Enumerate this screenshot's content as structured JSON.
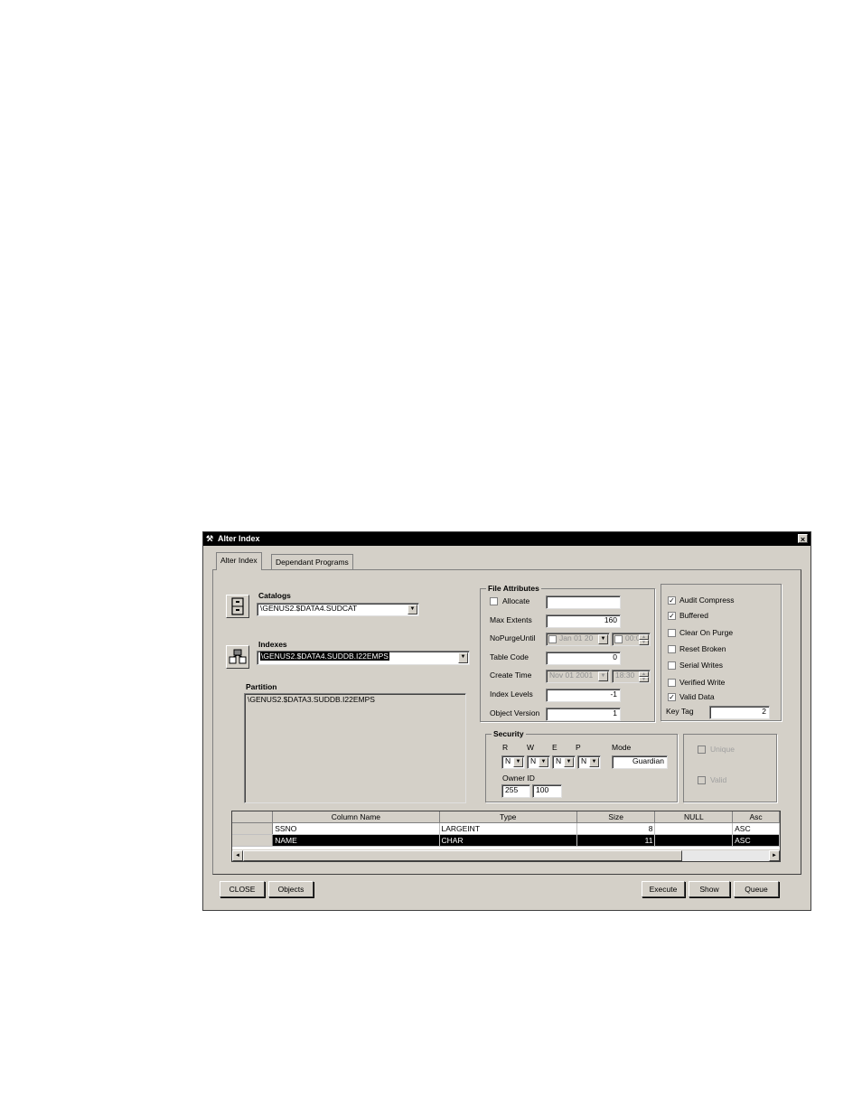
{
  "window": {
    "title": "Alter Index",
    "close_glyph": "×"
  },
  "tabs": [
    {
      "label": "Alter Index",
      "active": true
    },
    {
      "label": "Dependant Programs",
      "active": false
    }
  ],
  "catalogs": {
    "label": "Catalogs",
    "value": "\\GENUS2.$DATA4.SUDCAT"
  },
  "indexes": {
    "label": "Indexes",
    "value": "\\GENUS2.$DATA4.SUDDB.I22EMPS"
  },
  "partition": {
    "label": "Partition",
    "items": [
      "\\GENUS2.$DATA3.SUDDB.I22EMPS"
    ]
  },
  "file_attributes": {
    "title": "File Attributes",
    "allocate": {
      "label": "Allocate",
      "checked": false,
      "value": ""
    },
    "max_extents": {
      "label": "Max Extents",
      "value": "160"
    },
    "no_purge_until": {
      "label": "NoPurgeUntil",
      "date": "Jan 01 20",
      "time": "00:0"
    },
    "table_code": {
      "label": "Table Code",
      "value": "0"
    },
    "create_time": {
      "label": "Create Time",
      "date": "Nov 01 2001",
      "time": "18:30"
    },
    "index_levels": {
      "label": "Index Levels",
      "value": "-1"
    },
    "object_version": {
      "label": "Object Version",
      "value": "1"
    }
  },
  "flags": {
    "audit_compress": {
      "label": "Audit Compress",
      "checked": true
    },
    "buffered": {
      "label": "Buffered",
      "checked": true
    },
    "clear_on_purge": {
      "label": "Clear On Purge",
      "checked": false
    },
    "reset_broken": {
      "label": "Reset Broken",
      "checked": false
    },
    "serial_writes": {
      "label": "Serial Writes",
      "checked": false
    },
    "verified_write": {
      "label": "Verified Write",
      "checked": false
    },
    "valid_data": {
      "label": "Valid Data",
      "checked": true
    },
    "key_tag": {
      "label": "Key Tag",
      "value": "2"
    }
  },
  "security": {
    "title": "Security",
    "r": {
      "label": "R",
      "value": "N"
    },
    "w": {
      "label": "W",
      "value": "N"
    },
    "e": {
      "label": "E",
      "value": "N"
    },
    "p": {
      "label": "P",
      "value": "N"
    },
    "mode": {
      "label": "Mode",
      "value": "Guardian"
    },
    "owner_id": {
      "label": "Owner ID",
      "group": "255",
      "user": "100"
    }
  },
  "unique": {
    "label": "Unique",
    "checked": false
  },
  "valid": {
    "label": "Valid",
    "checked": false
  },
  "columns_grid": {
    "headers": [
      "Column Name",
      "Type",
      "Size",
      "NULL",
      "Asc"
    ],
    "rows": [
      {
        "name": "SSNO",
        "type": "LARGEINT",
        "size": "8",
        "null": "",
        "asc": "ASC",
        "selected": false
      },
      {
        "name": "NAME",
        "type": "CHAR",
        "size": "11",
        "null": "",
        "asc": "ASC",
        "selected": true
      }
    ]
  },
  "buttons": {
    "close": "CLOSE",
    "objects": "Objects",
    "execute": "Execute",
    "show": "Show",
    "queue": "Queue"
  },
  "icons": {
    "dropdown": "▼",
    "scroll_left": "◄",
    "scroll_right": "►",
    "spin_up": "▲",
    "spin_down": "▼",
    "check": "✓"
  }
}
